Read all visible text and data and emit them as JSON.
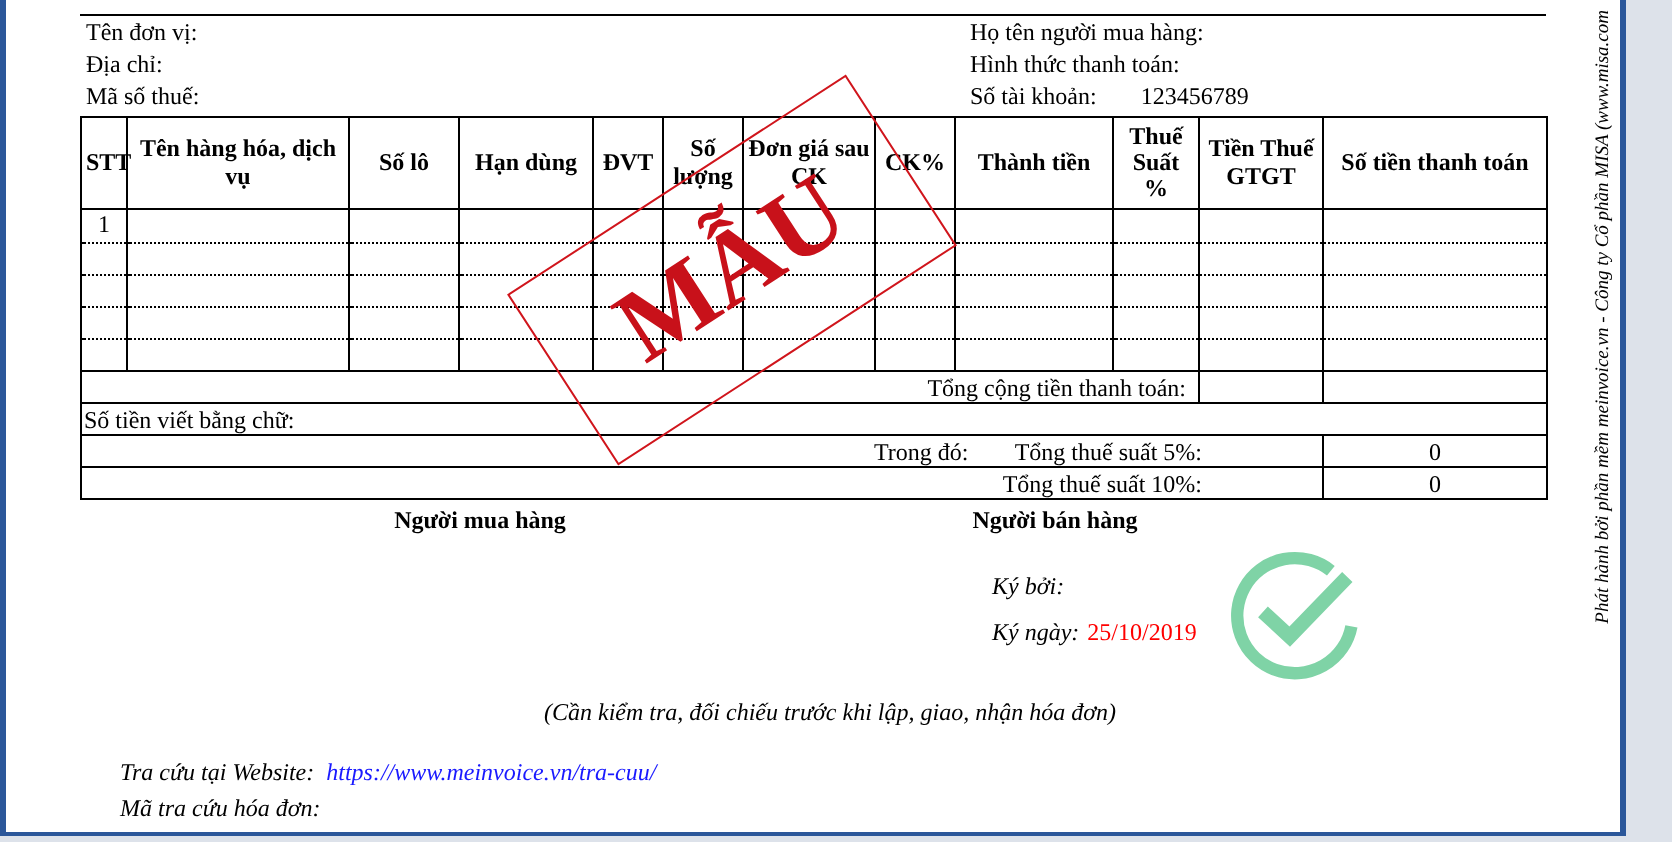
{
  "buyer_info": [
    {
      "label": "Tên đơn vị:"
    },
    {
      "label": "Địa chỉ:"
    },
    {
      "label": "Mã số thuế:"
    }
  ],
  "payment_info": [
    {
      "label": "Họ tên người mua hàng:"
    },
    {
      "label": "Hình thức thanh toán:"
    },
    {
      "label": "Số tài khoản:",
      "value": "123456789"
    }
  ],
  "table": {
    "columns": [
      "STT",
      "Tên hàng hóa, dịch vụ",
      "Số lô",
      "Hạn dùng",
      "ĐVT",
      "Số lượng",
      "Đơn giá sau CK",
      "CK%",
      "Thành tiền",
      "Thuế Suất %",
      "Tiền Thuế GTGT",
      "Số tiền thanh toán"
    ],
    "rows": [
      {
        "stt": "1"
      }
    ]
  },
  "totals": {
    "total_label": "Tổng cộng tiền thanh toán:",
    "in_words_label": "Số tiền viết bằng chữ:",
    "breakdown_label": "Trong đó:",
    "tax_rows": [
      {
        "label": "Tổng thuế suất 5%:",
        "value": "0"
      },
      {
        "label": "Tổng thuế suất 10%:",
        "value": "0"
      }
    ]
  },
  "stamp": "MẪU",
  "signatures": {
    "buyer": "Người mua hàng",
    "seller": "Người bán hàng",
    "signed_by_label": "Ký bởi:",
    "signed_date_label": "Ký ngày:",
    "signed_date": "25/10/2019"
  },
  "note": "(Cần kiểm tra, đối chiếu trước khi lập, giao, nhận hóa đơn)",
  "lookup": {
    "website_label": "Tra cứu tại Website:",
    "website_url": "https://www.meinvoice.vn/tra-cuu/",
    "code_label": "Mã tra cứu hóa đơn:"
  },
  "side_text": "Phát hành bởi phần mềm meinvoice.vn - Công ty Cổ phần MISA (www.misa.com"
}
